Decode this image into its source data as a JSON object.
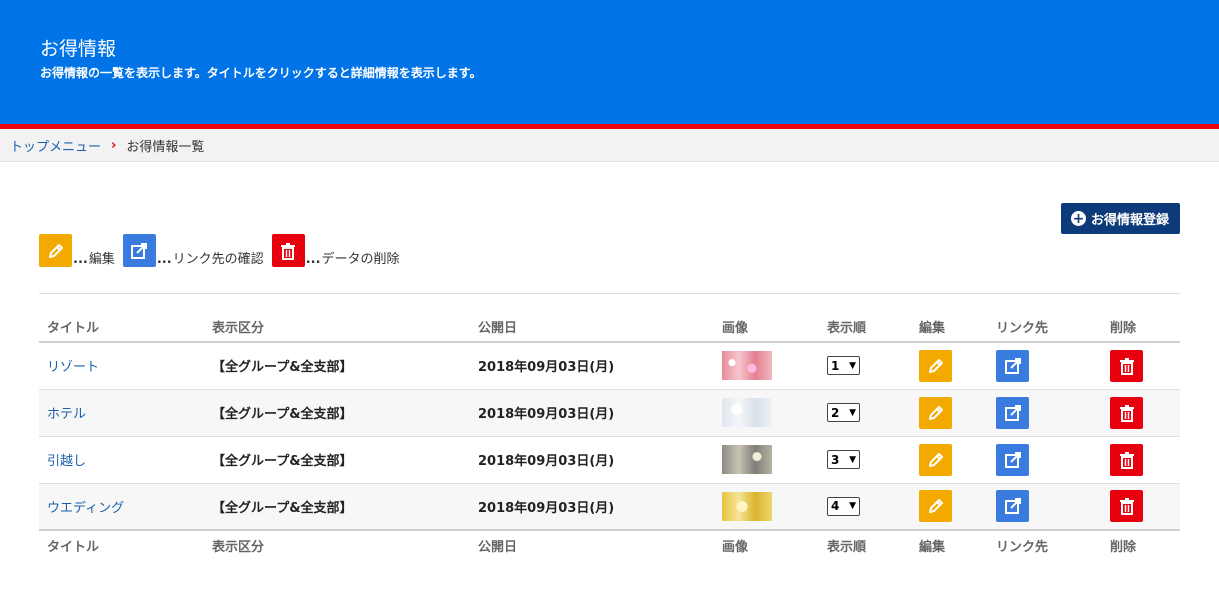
{
  "header": {
    "title": "お得情報",
    "description": "お得情報の一覧を表示します。タイトルをクリックすると詳細情報を表示します。"
  },
  "breadcrumb": {
    "home": "トップメニュー",
    "separator": "›",
    "current": "お得情報一覧"
  },
  "register_button": {
    "label": "お得情報登録"
  },
  "legend": {
    "dots": "...",
    "edit": "編集",
    "link": "リンク先の確認",
    "delete": "データの削除"
  },
  "columns": [
    "タイトル",
    "表示区分",
    "公開日",
    "画像",
    "表示順",
    "編集",
    "リンク先",
    "削除"
  ],
  "rows": [
    {
      "title": "リゾート",
      "category": "【全グループ&全支部】",
      "date": "2018年09月03日(月)",
      "order": "1",
      "thumb": "pink"
    },
    {
      "title": "ホテル",
      "category": "【全グループ&全支部】",
      "date": "2018年09月03日(月)",
      "order": "2",
      "thumb": "white"
    },
    {
      "title": "引越し",
      "category": "【全グループ&全支部】",
      "date": "2018年09月03日(月)",
      "order": "3",
      "thumb": "grey"
    },
    {
      "title": "ウエディング",
      "category": "【全グループ&全支部】",
      "date": "2018年09月03日(月)",
      "order": "4",
      "thumb": "gold"
    }
  ],
  "colors": {
    "header_bg": "#0073e6",
    "accent_red": "#e8000f",
    "edit": "#f2aa00",
    "link": "#3a7be0",
    "delete": "#e8000f",
    "button": "#0d3a7a"
  }
}
